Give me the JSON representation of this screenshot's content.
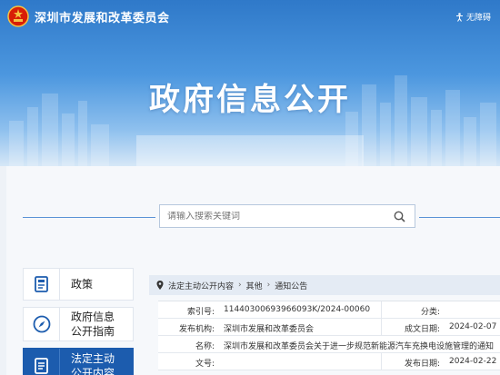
{
  "header": {
    "site_title": "深圳市发展和改革委员会",
    "accessibility_label": "无障碍",
    "hero_title": "政府信息公开"
  },
  "search": {
    "placeholder": "请输入搜索关键词"
  },
  "sidebar": {
    "items": [
      {
        "label": "政策",
        "icon": "document-icon",
        "active": false
      },
      {
        "label": "政府信息\n公开指南",
        "icon": "compass-icon",
        "active": false
      },
      {
        "label": "法定主动\n公开内容",
        "icon": "list-document-icon",
        "active": true
      }
    ]
  },
  "breadcrumb": [
    "法定主动公开内容",
    "其他",
    "通知公告"
  ],
  "info": {
    "index_label": "索引号:",
    "index_value": "11440300693966093K/2024-00060",
    "category_label": "分类:",
    "category_value": "",
    "publisher_label": "发布机构:",
    "publisher_value": "深圳市发展和改革委员会",
    "created_label": "成文日期:",
    "created_value": "2024-02-07",
    "name_label": "名称:",
    "name_value": "深圳市发展和改革委员会关于进一步规范新能源汽车充换电设施管理的通知",
    "doc_no_label": "文号:",
    "doc_no_value": "",
    "published_label": "发布日期:",
    "published_value": "2024-02-22"
  },
  "colors": {
    "accent": "#1c5cae",
    "banner_top": "#2f79c9"
  }
}
